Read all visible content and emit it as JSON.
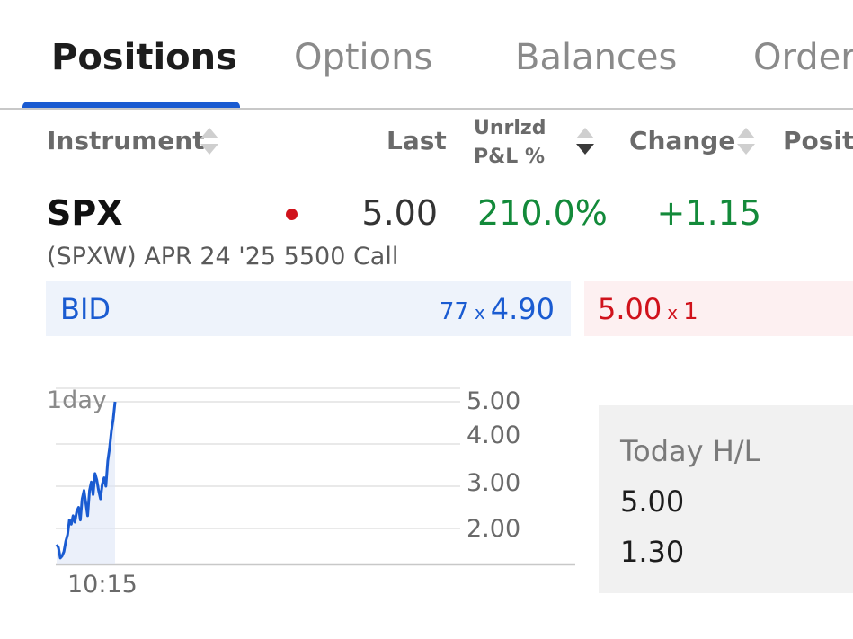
{
  "tabs": [
    {
      "label": "Positions",
      "active": true
    },
    {
      "label": "Options",
      "active": false
    },
    {
      "label": "Balances",
      "active": false
    },
    {
      "label": "Orders",
      "active": false
    }
  ],
  "columns": {
    "instrument": "Instrument",
    "last": "Last",
    "unrlzd_line1": "Unrlzd",
    "unrlzd_line2": "P&L %",
    "change": "Change",
    "position": "Position"
  },
  "position": {
    "symbol": "SPX",
    "last": "5.00",
    "unrealized_pnl_pct": "210.0%",
    "change": "+1.15",
    "description": "(SPXW) APR 24 '25 5500 Call"
  },
  "quote": {
    "bid_label": "BID",
    "bid_size": "77",
    "bid_price": "4.90",
    "ask_price": "5.00",
    "ask_size": "1",
    "x": "x"
  },
  "colors": {
    "accent": "#1a5bd1",
    "positive": "#138a3a",
    "negative": "#d0121b"
  },
  "chart_data": {
    "type": "line",
    "range_label": "1day",
    "x_ticks": [
      "10:15"
    ],
    "y_ticks": [
      "5.00",
      "4.00",
      "3.00",
      "2.00"
    ],
    "ylim": [
      1.3,
      5.0
    ],
    "series": [
      {
        "values": [
          1.62,
          1.55,
          1.3,
          1.35,
          1.45,
          1.7,
          1.85,
          2.2,
          2.1,
          2.3,
          2.15,
          2.4,
          2.5,
          2.2,
          2.7,
          2.9,
          2.6,
          2.3,
          2.9,
          3.1,
          2.8,
          3.3,
          3.15,
          2.9,
          2.7,
          3.05,
          3.2,
          3.0,
          3.6,
          3.9,
          4.3,
          4.6,
          5.0
        ]
      }
    ]
  },
  "today_hl": {
    "title": "Today H/L",
    "high": "5.00",
    "low": "1.30"
  }
}
